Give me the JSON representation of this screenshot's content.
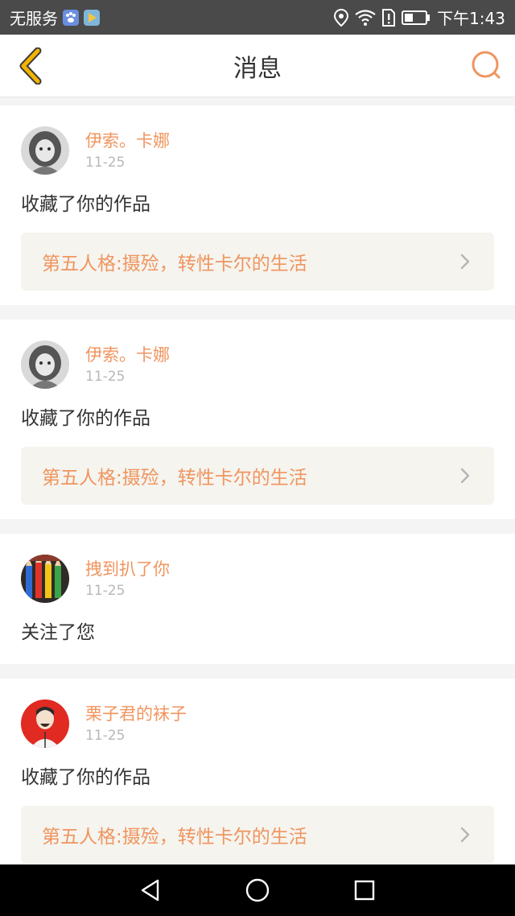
{
  "status_bar": {
    "carrier": "无服务",
    "time": "下午1:43"
  },
  "header": {
    "title": "消息"
  },
  "messages": [
    {
      "username": "伊索。卡娜",
      "date": "11-25",
      "action": "收藏了你的作品",
      "work_title": "第五人格:摄殓，转性卡尔的生活"
    },
    {
      "username": "伊索。卡娜",
      "date": "11-25",
      "action": "收藏了你的作品",
      "work_title": "第五人格:摄殓，转性卡尔的生活"
    },
    {
      "username": "拽到扒了你",
      "date": "11-25",
      "action": "关注了您"
    },
    {
      "username": "栗子君的袜子",
      "date": "11-25",
      "action": "收藏了你的作品",
      "work_title": "第五人格:摄殓，转性卡尔的生活"
    }
  ],
  "colors": {
    "accent": "#f0955f",
    "back_arrow": "#f2b400",
    "status_bar": "#4a4a4a"
  }
}
